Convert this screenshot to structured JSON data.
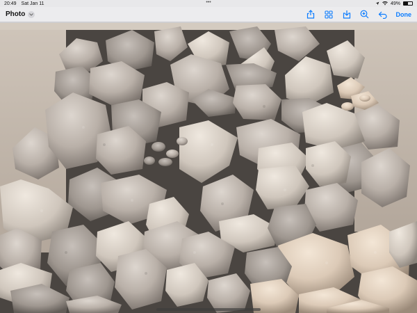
{
  "status_bar": {
    "time": "20:49",
    "date": "Sat Jan 11",
    "dots": "•••",
    "battery": "49%",
    "battery_level": 0.49,
    "icons": [
      "location-icon",
      "wifi-icon",
      "battery-icon"
    ]
  },
  "nav": {
    "title": "Photo",
    "done_label": "Done",
    "accent_color": "#0a7cff",
    "icons": [
      "share-icon",
      "grid-icon",
      "save-icon",
      "zoom-in-icon",
      "undo-icon"
    ]
  },
  "photo": {
    "subject": "box of pale crushed stones"
  }
}
